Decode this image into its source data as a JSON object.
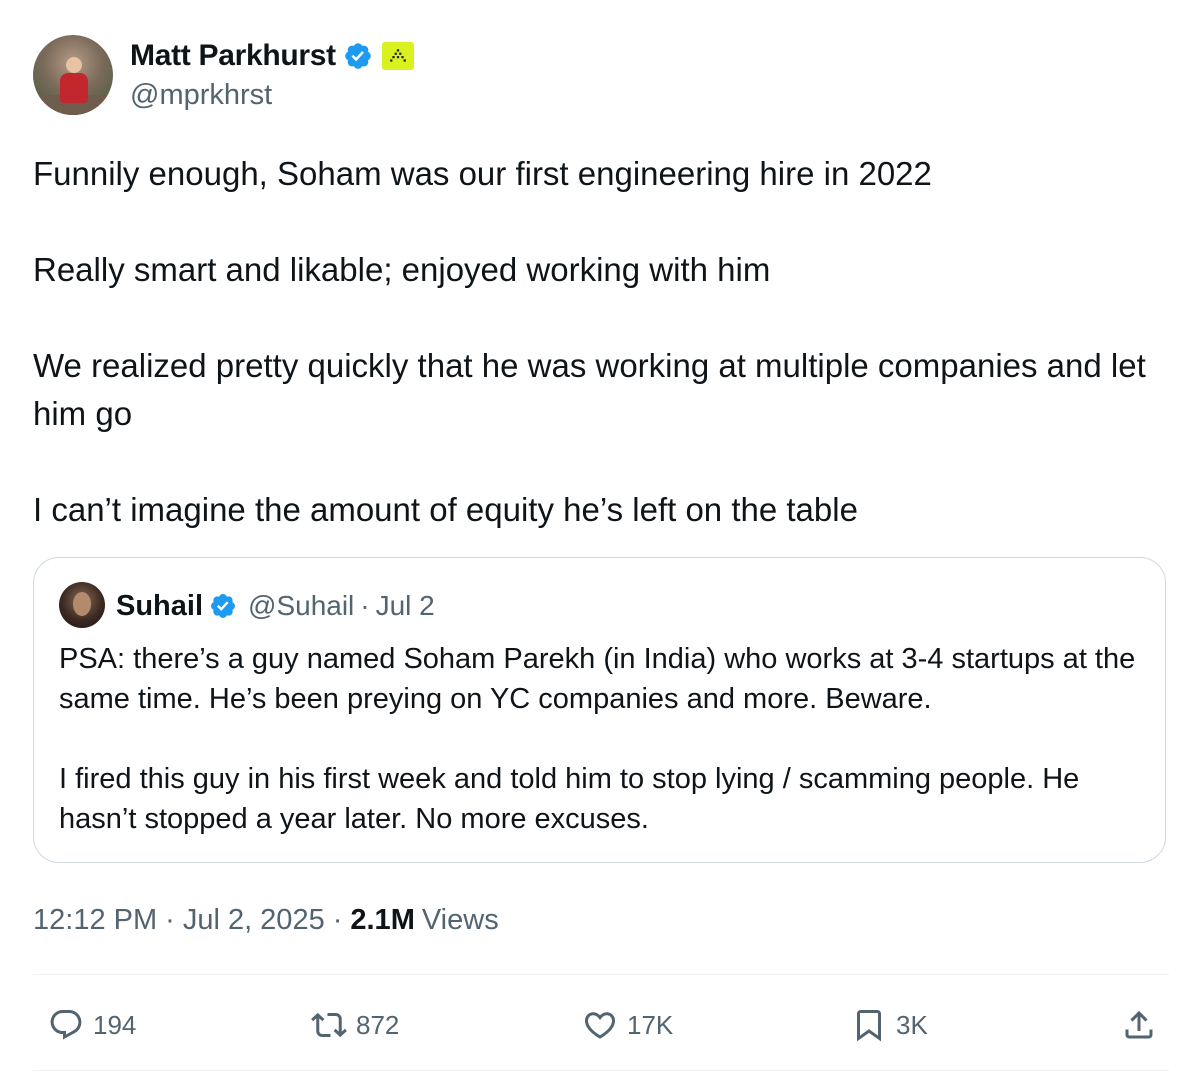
{
  "author": {
    "display_name": "Matt Parkhurst",
    "handle": "@mprkhrst",
    "verified": true,
    "affiliate_badge_color": "#d9f21f"
  },
  "tweet": {
    "paragraphs": [
      "Funnily enough, Soham was our first engineering hire in 2022",
      "Really smart and likable; enjoyed working with him",
      "We realized pretty quickly that he was working at multiple companies and let him go",
      "I can’t imagine the amount of equity he’s left on the table"
    ]
  },
  "quoted_tweet": {
    "display_name": "Suhail",
    "handle": "@Suhail",
    "separator": "·",
    "date": "Jul 2",
    "verified": true,
    "paragraphs": [
      "PSA: there’s a guy named Soham Parekh (in India) who works at 3-4 startups at the same time. He’s been preying on YC companies and more. Beware.",
      "I fired this guy in his first week and told him to stop lying / scamming people. He hasn’t stopped a year later. No more excuses."
    ]
  },
  "meta": {
    "time": "12:12 PM",
    "separator": "·",
    "date": "Jul 2, 2025",
    "views_count": "2.1M",
    "views_label": "Views"
  },
  "actions": {
    "replies": "194",
    "reposts": "872",
    "likes": "17K",
    "bookmarks": "3K"
  },
  "icons": {
    "verified": "verified-badge-icon",
    "reply": "speech-bubble-icon",
    "repost": "repost-arrows-icon",
    "like": "heart-icon",
    "bookmark": "bookmark-icon",
    "share": "share-upload-icon"
  },
  "colors": {
    "verified_blue": "#1d9bf0",
    "secondary_text": "#536471",
    "primary_text": "#0f1419",
    "border": "#cfd9de"
  }
}
